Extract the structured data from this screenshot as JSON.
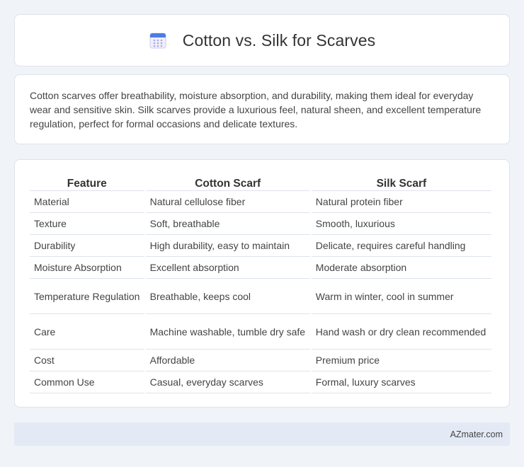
{
  "header": {
    "title": "Cotton vs. Silk for Scarves",
    "icon": "calendar-icon"
  },
  "intro": {
    "text": "Cotton scarves offer breathability, moisture absorption, and durability, making them ideal for everyday wear and sensitive skin. Silk scarves provide a luxurious feel, natural sheen, and excellent temperature regulation, perfect for formal occasions and delicate textures."
  },
  "table": {
    "headers": [
      "Feature",
      "Cotton Scarf",
      "Silk Scarf"
    ],
    "rows": [
      [
        "Material",
        "Natural cellulose fiber",
        "Natural protein fiber"
      ],
      [
        "Texture",
        "Soft, breathable",
        "Smooth, luxurious"
      ],
      [
        "Durability",
        "High durability, easy to maintain",
        "Delicate, requires careful handling"
      ],
      [
        "Moisture Absorption",
        "Excellent absorption",
        "Moderate absorption"
      ],
      [
        "Temperature Regulation",
        "Breathable, keeps cool",
        "Warm in winter, cool in summer"
      ],
      [
        "Care",
        "Machine washable, tumble dry safe",
        "Hand wash or dry clean recommended"
      ],
      [
        "Cost",
        "Affordable",
        "Premium price"
      ],
      [
        "Common Use",
        "Casual, everyday scarves",
        "Formal, luxury scarves"
      ]
    ]
  },
  "footer": {
    "brand": "AZmater.com"
  }
}
